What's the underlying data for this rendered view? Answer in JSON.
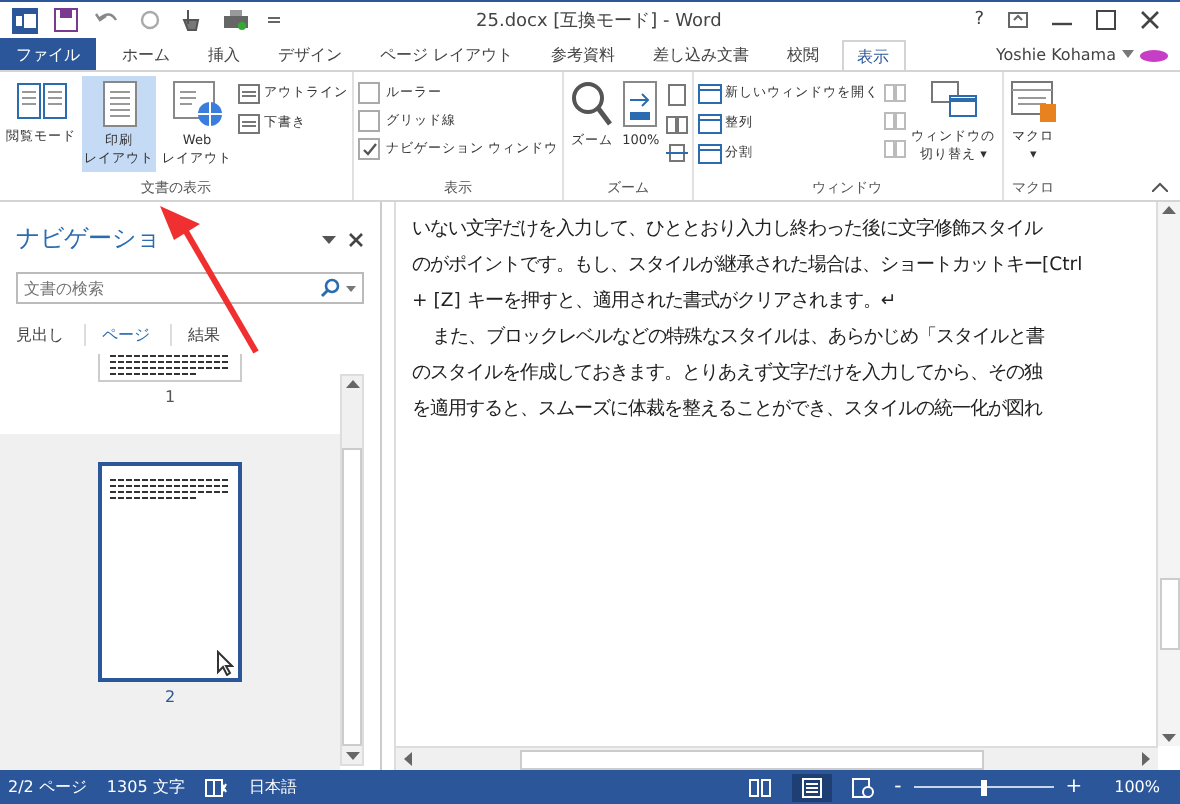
{
  "window": {
    "title": "25.docx [互換モード] - Word",
    "help": "?"
  },
  "tabs": [
    {
      "label": "ファイル",
      "selected": false,
      "kind": "file"
    },
    {
      "label": "ホーム",
      "selected": false,
      "kind": "tab"
    },
    {
      "label": "挿入",
      "selected": false,
      "kind": "tab"
    },
    {
      "label": "デザイン",
      "selected": false,
      "kind": "tab"
    },
    {
      "label": "ページ レイアウト",
      "selected": false,
      "kind": "tab"
    },
    {
      "label": "参考資料",
      "selected": false,
      "kind": "tab"
    },
    {
      "label": "差し込み文書",
      "selected": false,
      "kind": "tab"
    },
    {
      "label": "校閲",
      "selected": false,
      "kind": "tab"
    },
    {
      "label": "表示",
      "selected": true,
      "kind": "tab"
    }
  ],
  "user": "Yoshie Kohama",
  "ribbon": {
    "views": {
      "label": "文書の表示",
      "buttons": [
        {
          "label": [
            "閲覧モード"
          ],
          "selected": false
        },
        {
          "label": [
            "印刷",
            "レイアウト"
          ],
          "selected": true
        },
        {
          "label": [
            "Web",
            "レイアウト"
          ],
          "selected": false
        }
      ],
      "small": [
        "アウトライン",
        "下書き"
      ]
    },
    "show": {
      "label": "表示",
      "checks": [
        {
          "label": "ルーラー",
          "checked": false
        },
        {
          "label": "グリッド線",
          "checked": false
        },
        {
          "label": "ナビゲーション ウィンドウ",
          "checked": true
        }
      ]
    },
    "zoom": {
      "label": "ズーム",
      "buttons": [
        "ズーム",
        "100%"
      ]
    },
    "window": {
      "label": "ウィンドウ",
      "small": [
        "新しいウィンドウを開く",
        "整列",
        "分割"
      ],
      "switch": [
        "ウィンドウの",
        "切り替え ▾"
      ]
    },
    "macro": {
      "label": "マクロ",
      "button": [
        "マクロ",
        "▾"
      ]
    }
  },
  "nav": {
    "title": "ナビゲーショ",
    "search": {
      "placeholder": "文書の検索"
    },
    "tabs": [
      {
        "label": "見出し",
        "selected": false
      },
      {
        "label": "ページ",
        "selected": true
      },
      {
        "label": "結果",
        "selected": false
      }
    ],
    "pages": [
      {
        "number": "1",
        "selected": false
      },
      {
        "number": "2",
        "selected": true
      }
    ]
  },
  "document": {
    "lines": [
      {
        "text": "いない文字だけを入力して、ひととおり入力し終わった後に文字修飾スタイル",
        "indent": false
      },
      {
        "text": "のがポイントです。もし、スタイルが継承された場合は、ショートカットキー[Ctrl",
        "indent": false
      },
      {
        "text": "+ [Z] キーを押すと、適用された書式がクリアされます。↵",
        "indent": false
      },
      {
        "text": "また、ブロックレベルなどの特殊なスタイルは、あらかじめ「スタイルと書",
        "indent": true
      },
      {
        "text": "のスタイルを作成しておきます。とりあえず文字だけを入力してから、その独",
        "indent": false
      },
      {
        "text": "を適用すると、スムーズに体裁を整えることができ、スタイルの統一化が図れ",
        "indent": false
      }
    ]
  },
  "status_bar": {
    "page": "2/2 ページ",
    "words": "1305 文字",
    "language": "日本語",
    "zoom_minus": "-",
    "zoom_plus": "+",
    "zoom": {
      "level": 0.5
    },
    "zoom_label": "100%"
  }
}
